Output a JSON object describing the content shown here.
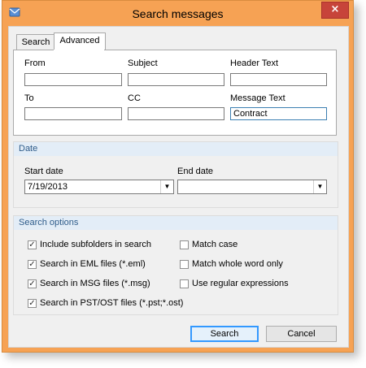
{
  "window": {
    "title": "Search messages",
    "close_glyph": "×",
    "close_icon": "close-icon",
    "app_icon": "app-icon"
  },
  "tabs": [
    {
      "label": "Search",
      "selected": false
    },
    {
      "label": "Advanced",
      "selected": true
    }
  ],
  "advanced": {
    "from_label": "From",
    "from_value": "",
    "subject_label": "Subject",
    "subject_value": "",
    "header_label": "Header Text",
    "header_value": "",
    "to_label": "To",
    "to_value": "",
    "cc_label": "CC",
    "cc_value": "",
    "message_label": "Message Text",
    "message_value": "Contract"
  },
  "date": {
    "header": "Date",
    "start_label": "Start date",
    "start_value": "7/19/2013",
    "end_label": "End date",
    "end_value": ""
  },
  "options": {
    "header": "Search options",
    "left": [
      {
        "label": "Include subfolders in search",
        "checked": true
      },
      {
        "label": "Search in EML files (*.eml)",
        "checked": true
      },
      {
        "label": "Search in MSG files (*.msg)",
        "checked": true
      },
      {
        "label": "Search in PST/OST files (*.pst;*.ost)",
        "checked": true
      }
    ],
    "right": [
      {
        "label": "Match case",
        "checked": false
      },
      {
        "label": "Match whole word only",
        "checked": false
      },
      {
        "label": "Use regular expressions",
        "checked": false
      }
    ]
  },
  "buttons": {
    "search": "Search",
    "cancel": "Cancel"
  },
  "glyphs": {
    "check": "✓",
    "dropdown": "▼"
  },
  "colors": {
    "title_bar": "#f6a254",
    "close_button": "#c7443a",
    "group_header": "#e3edf7",
    "default_button_border": "#3399ff"
  }
}
